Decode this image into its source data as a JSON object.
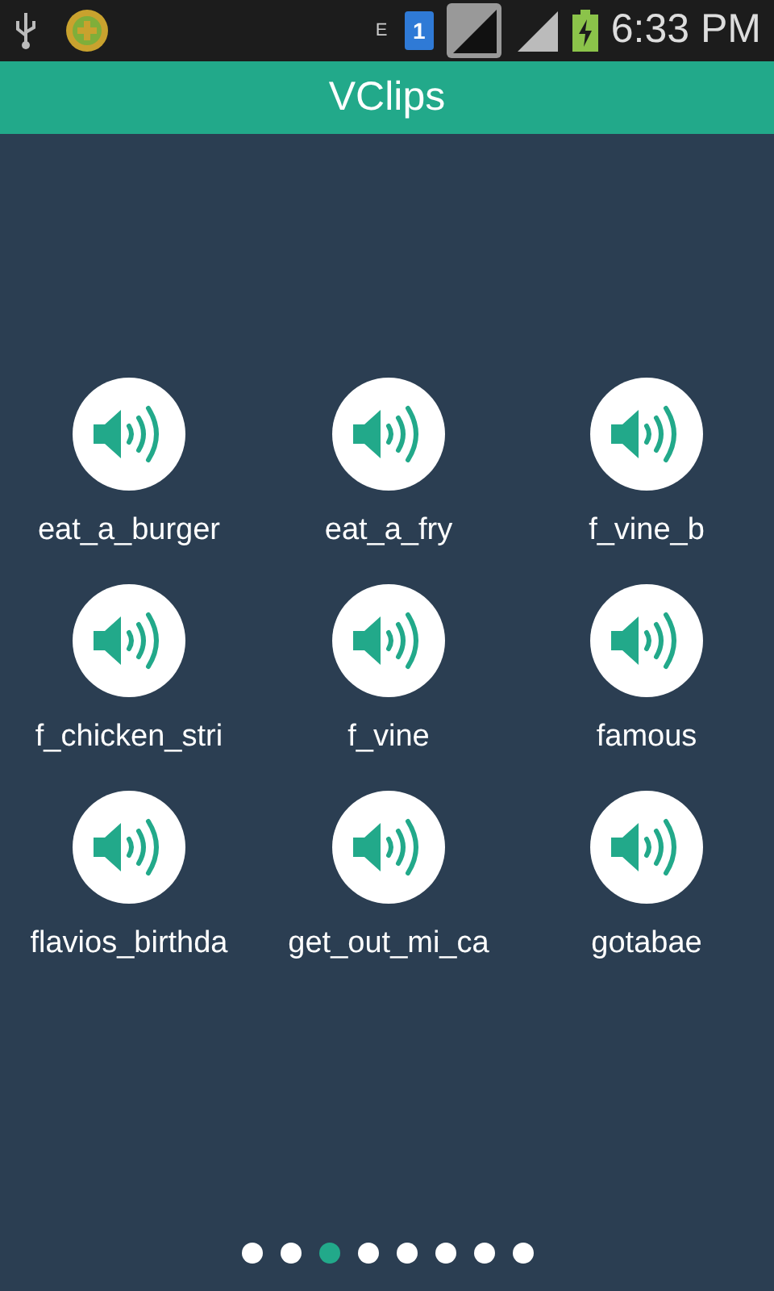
{
  "status_bar": {
    "network_type": "E",
    "sim_slot": "1",
    "time": "6:33 PM"
  },
  "app_bar": {
    "title": "VClips"
  },
  "clips": [
    {
      "label": "eat_a_burger"
    },
    {
      "label": "eat_a_fry"
    },
    {
      "label": "f_vine_b"
    },
    {
      "label": "f_chicken_stri"
    },
    {
      "label": "f_vine"
    },
    {
      "label": "famous"
    },
    {
      "label": "flavios_birthda"
    },
    {
      "label": "get_out_mi_ca"
    },
    {
      "label": "gotabae"
    }
  ],
  "pages": [
    {
      "selected": false
    },
    {
      "selected": false
    },
    {
      "selected": true
    },
    {
      "selected": false
    },
    {
      "selected": false
    },
    {
      "selected": false
    },
    {
      "selected": false
    },
    {
      "selected": false
    }
  ]
}
